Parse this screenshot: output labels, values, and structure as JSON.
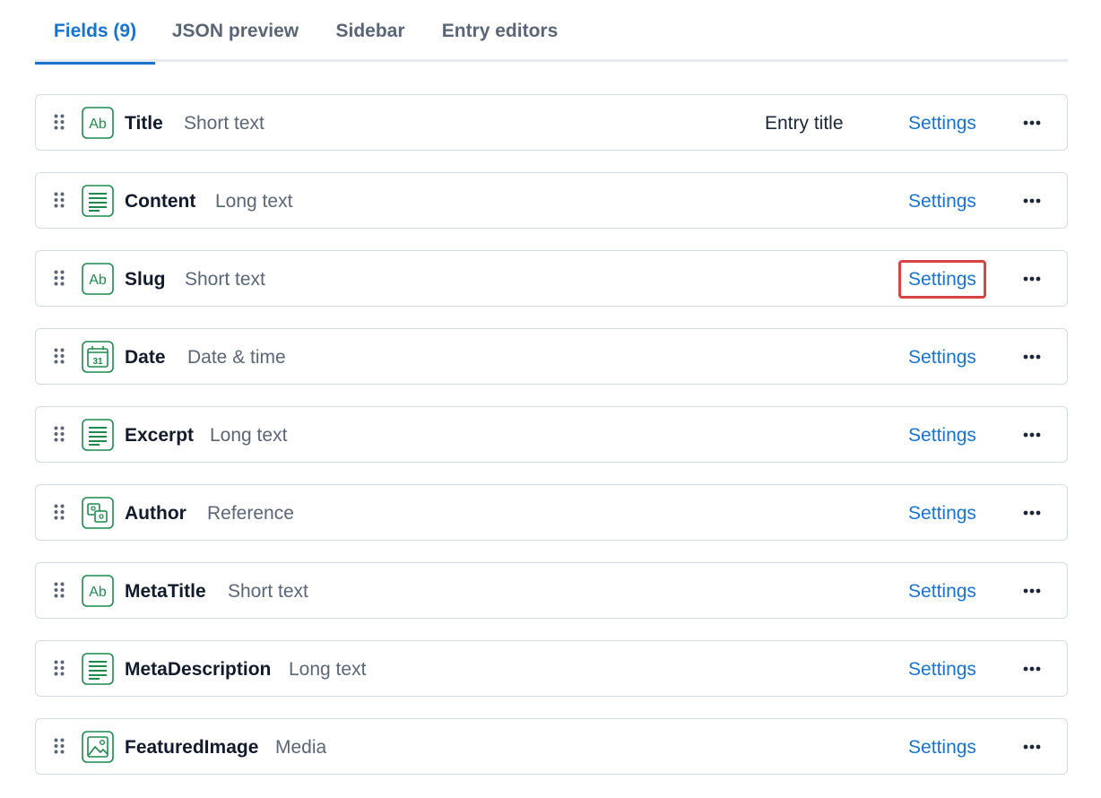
{
  "tabs": [
    {
      "label": "Fields (9)",
      "active": true
    },
    {
      "label": "JSON preview",
      "active": false
    },
    {
      "label": "Sidebar",
      "active": false
    },
    {
      "label": "Entry editors",
      "active": false
    }
  ],
  "fields": [
    {
      "name": "Title",
      "type": "Short text",
      "icon": "short-text-icon",
      "extra": "Entry title",
      "settings": "Settings"
    },
    {
      "name": "Content",
      "type": "Long text",
      "icon": "long-text-icon",
      "settings": "Settings"
    },
    {
      "name": "Slug",
      "type": "Short text",
      "icon": "short-text-icon",
      "settings": "Settings",
      "highlighted": true
    },
    {
      "name": "Date",
      "type": "Date & time",
      "icon": "calendar-icon",
      "settings": "Settings"
    },
    {
      "name": "Excerpt",
      "type": "Long text",
      "icon": "long-text-icon",
      "settings": "Settings"
    },
    {
      "name": "Author",
      "type": "Reference",
      "icon": "reference-icon",
      "settings": "Settings"
    },
    {
      "name": "MetaTitle",
      "type": "Short text",
      "icon": "short-text-icon",
      "settings": "Settings"
    },
    {
      "name": "MetaDescription",
      "type": "Long text",
      "icon": "long-text-icon",
      "settings": "Settings"
    },
    {
      "name": "FeaturedImage",
      "type": "Media",
      "icon": "media-icon",
      "settings": "Settings"
    }
  ],
  "icon_glyphs": {
    "short_text": "Ab",
    "date": "31"
  },
  "colors": {
    "accent": "#1873cf",
    "icon_green": "#1f8a4c",
    "highlight": "#d64545"
  }
}
